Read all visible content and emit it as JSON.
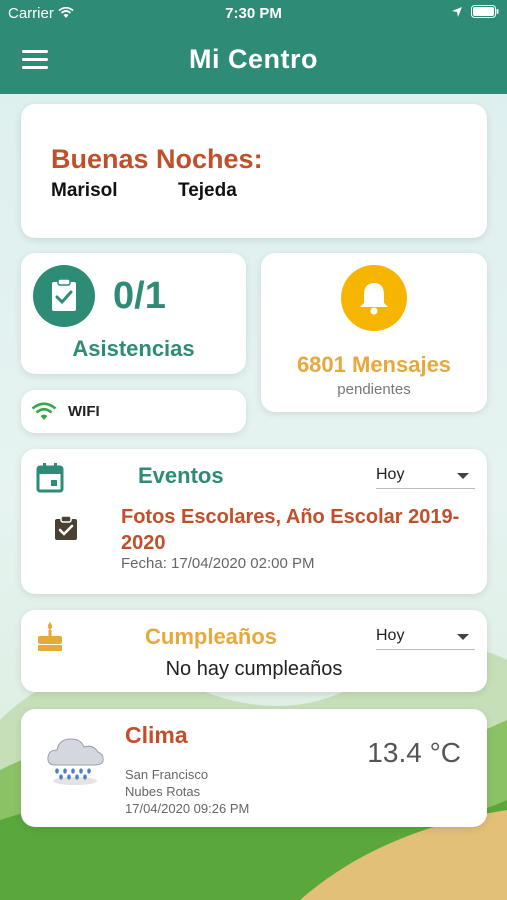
{
  "status_bar": {
    "carrier": "Carrier",
    "time": "7:30 PM"
  },
  "nav": {
    "title": "Mi Centro",
    "menu_icon": "hamburger-menu-icon"
  },
  "greeting": {
    "salutation": "Buenas Noches:",
    "first_name": "Marisol",
    "last_name": "Tejeda"
  },
  "attendance": {
    "count": "0/1",
    "label": "Asistencias",
    "icon": "clipboard-check-icon"
  },
  "wifi": {
    "label": "WIFI",
    "icon": "wifi-icon"
  },
  "messages": {
    "count_label": "6801 Mensajes",
    "sub_label": "pendientes",
    "icon": "bell-icon"
  },
  "events": {
    "title": "Eventos",
    "filter": "Hoy",
    "item_title": "Fotos Escolares, Año Escolar 2019-2020",
    "item_date": "Fecha: 17/04/2020 02:00 PM",
    "icon": "calendar-icon"
  },
  "birthdays": {
    "title": "Cumpleaños",
    "filter": "Hoy",
    "empty_text": "No hay cumpleaños",
    "icon": "cake-icon"
  },
  "weather": {
    "title": "Clima",
    "temperature": "13.4 °C",
    "city": "San Francisco",
    "description": "Nubes Rotas",
    "datetime": "17/04/2020 09:26 PM",
    "icon": "rain-cloud-icon"
  },
  "colors": {
    "primary": "#2e8b76",
    "accent_red": "#c14f2c",
    "accent_orange": "#e7a83c",
    "bell_yellow": "#f6b500"
  }
}
